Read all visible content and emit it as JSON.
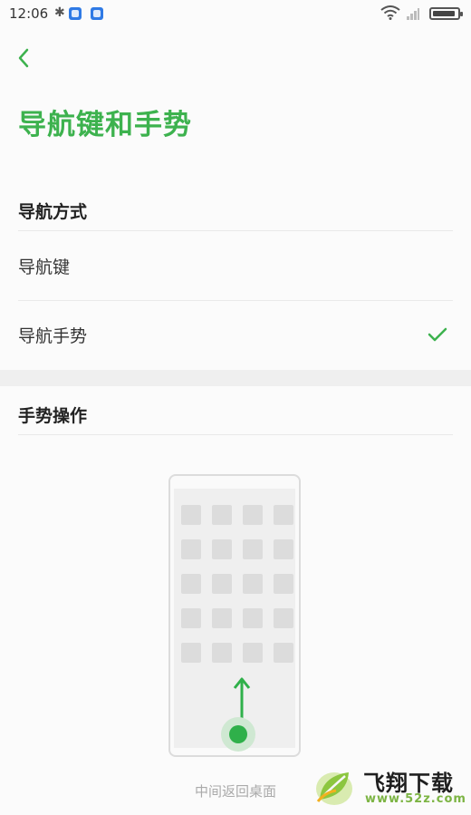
{
  "status_bar": {
    "time": "12:06",
    "icons": [
      "bluetooth-icon",
      "notification-icon",
      "notification-icon",
      "wifi-icon",
      "signal-icon",
      "battery-icon"
    ]
  },
  "header": {
    "back_icon": "chevron-left-icon",
    "title": "导航键和手势"
  },
  "navigation_section": {
    "header": "导航方式",
    "options": [
      {
        "label": "导航键",
        "selected": false
      },
      {
        "label": "导航手势",
        "selected": true
      }
    ]
  },
  "gesture_section": {
    "header": "手势操作",
    "illustration": {
      "caption": "中间返回桌面"
    }
  },
  "watermark": {
    "title": "飞翔下载",
    "url": "www.52z.com"
  },
  "colors": {
    "accent": "#3db24e",
    "background": "#fbfbfb",
    "divider": "#e9e9e9"
  }
}
